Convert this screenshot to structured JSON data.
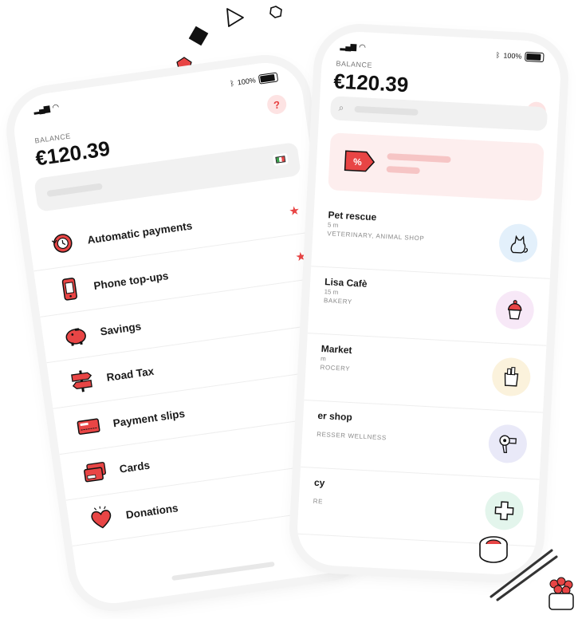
{
  "left_phone": {
    "status": {
      "battery": "100%"
    },
    "balance_label": "BALANCE",
    "balance_amount": "€120.39",
    "help_label": "?",
    "menu": [
      {
        "label": "Automatic payments",
        "icon": "automatic-payments-icon",
        "starred": true
      },
      {
        "label": "Phone top-ups",
        "icon": "phone-icon",
        "starred": true
      },
      {
        "label": "Savings",
        "icon": "piggy-bank-icon",
        "starred": true
      },
      {
        "label": "Road Tax",
        "icon": "road-sign-icon",
        "starred": false
      },
      {
        "label": "Payment slips",
        "icon": "payment-slip-icon",
        "starred": false
      },
      {
        "label": "Cards",
        "icon": "cards-icon",
        "starred": false
      },
      {
        "label": "Donations",
        "icon": "heart-icon",
        "starred": false
      }
    ]
  },
  "right_phone": {
    "status": {
      "battery": "100%"
    },
    "balance_label": "BALANCE",
    "balance_amount": "€120.39",
    "help_label": "?",
    "stores": [
      {
        "name": "Pet rescue",
        "distance": "5 m",
        "category": "VETERINARY, ANIMAL SHOP",
        "icon": "cat-icon",
        "color": "#e3f0fb"
      },
      {
        "name": "Lisa Cafè",
        "distance": "15 m",
        "category": "BAKERY",
        "icon": "cupcake-icon",
        "color": "#f7e8f7"
      },
      {
        "name": "Market",
        "distance": "m",
        "category": "ROCERY",
        "icon": "grocery-bag-icon",
        "color": "#fbf2dc"
      },
      {
        "name": "er shop",
        "distance": "",
        "category": "RESSER WELLNESS",
        "icon": "hair-dryer-icon",
        "color": "#e9e9f8"
      },
      {
        "name": "cy",
        "distance": "",
        "category": "RE",
        "icon": "pharmacy-cross-icon",
        "color": "#e3f5ec"
      }
    ]
  },
  "colors": {
    "accent": "#e84545",
    "inactive_star": "#cfcfcf"
  }
}
